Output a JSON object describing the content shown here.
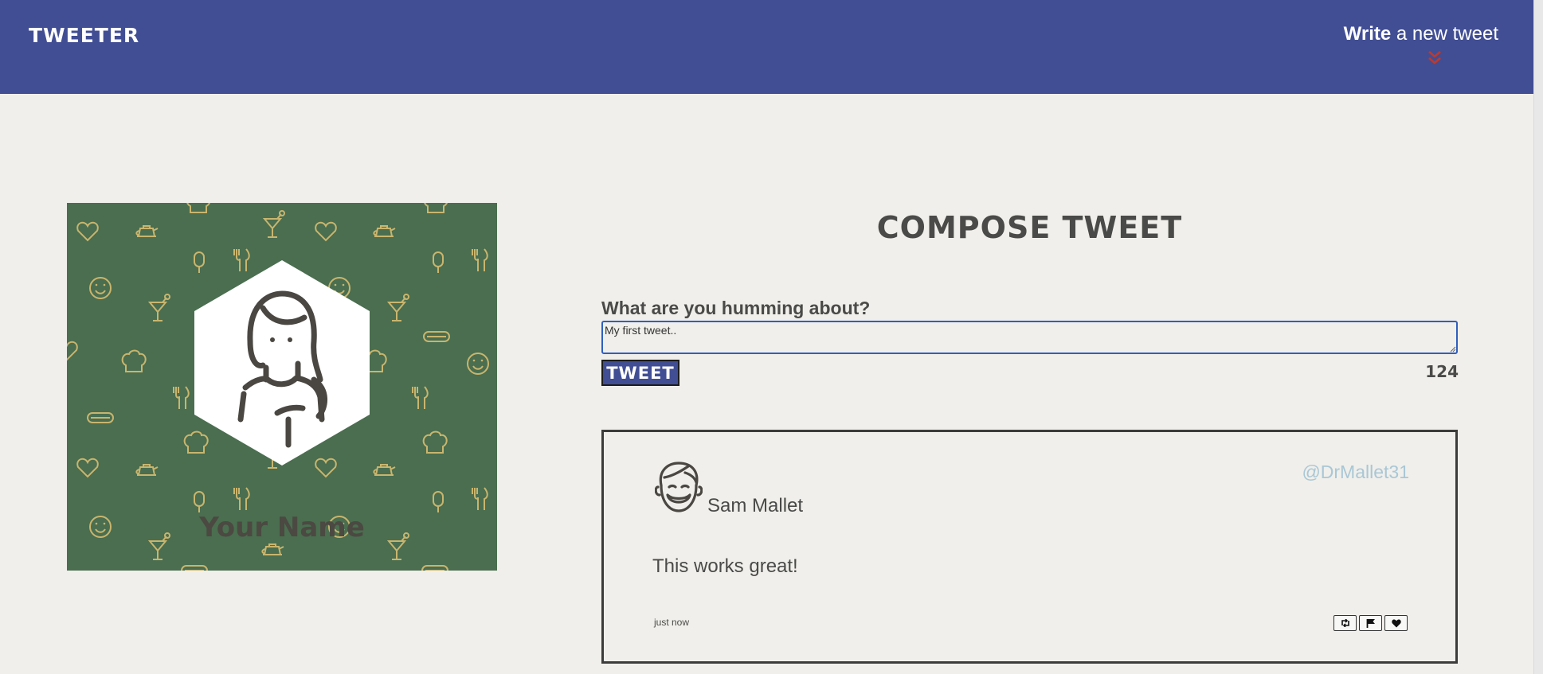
{
  "nav": {
    "brand": "TWEETER",
    "write_bold": "Write",
    "write_rest": " a new tweet",
    "chevron_icon": "double-chevron-down-icon",
    "chevron_color": "#c0392b"
  },
  "profile": {
    "name": "Your Name",
    "avatar_icon": "woman-avatar-icon",
    "background_color": "#4a6e4f",
    "pattern_color": "#c9b56e"
  },
  "compose": {
    "title": "COMPOSE TWEET",
    "label": "What are you humming about?",
    "input_value": "My first tweet..",
    "button_label": "TWEET",
    "counter": "124"
  },
  "tweet": {
    "avatar_icon": "smiling-man-avatar-icon",
    "name": "Sam Mallet",
    "handle": "@DrMallet31",
    "text": "This works great!",
    "timestamp": "just now",
    "actions": [
      "retweet-icon",
      "flag-icon",
      "heart-icon"
    ]
  },
  "colors": {
    "nav_bg": "#414e94",
    "page_bg": "#f0efeb",
    "text": "#4a4a48",
    "handle": "#a9c7d6",
    "input_border": "#2f5fbd"
  }
}
